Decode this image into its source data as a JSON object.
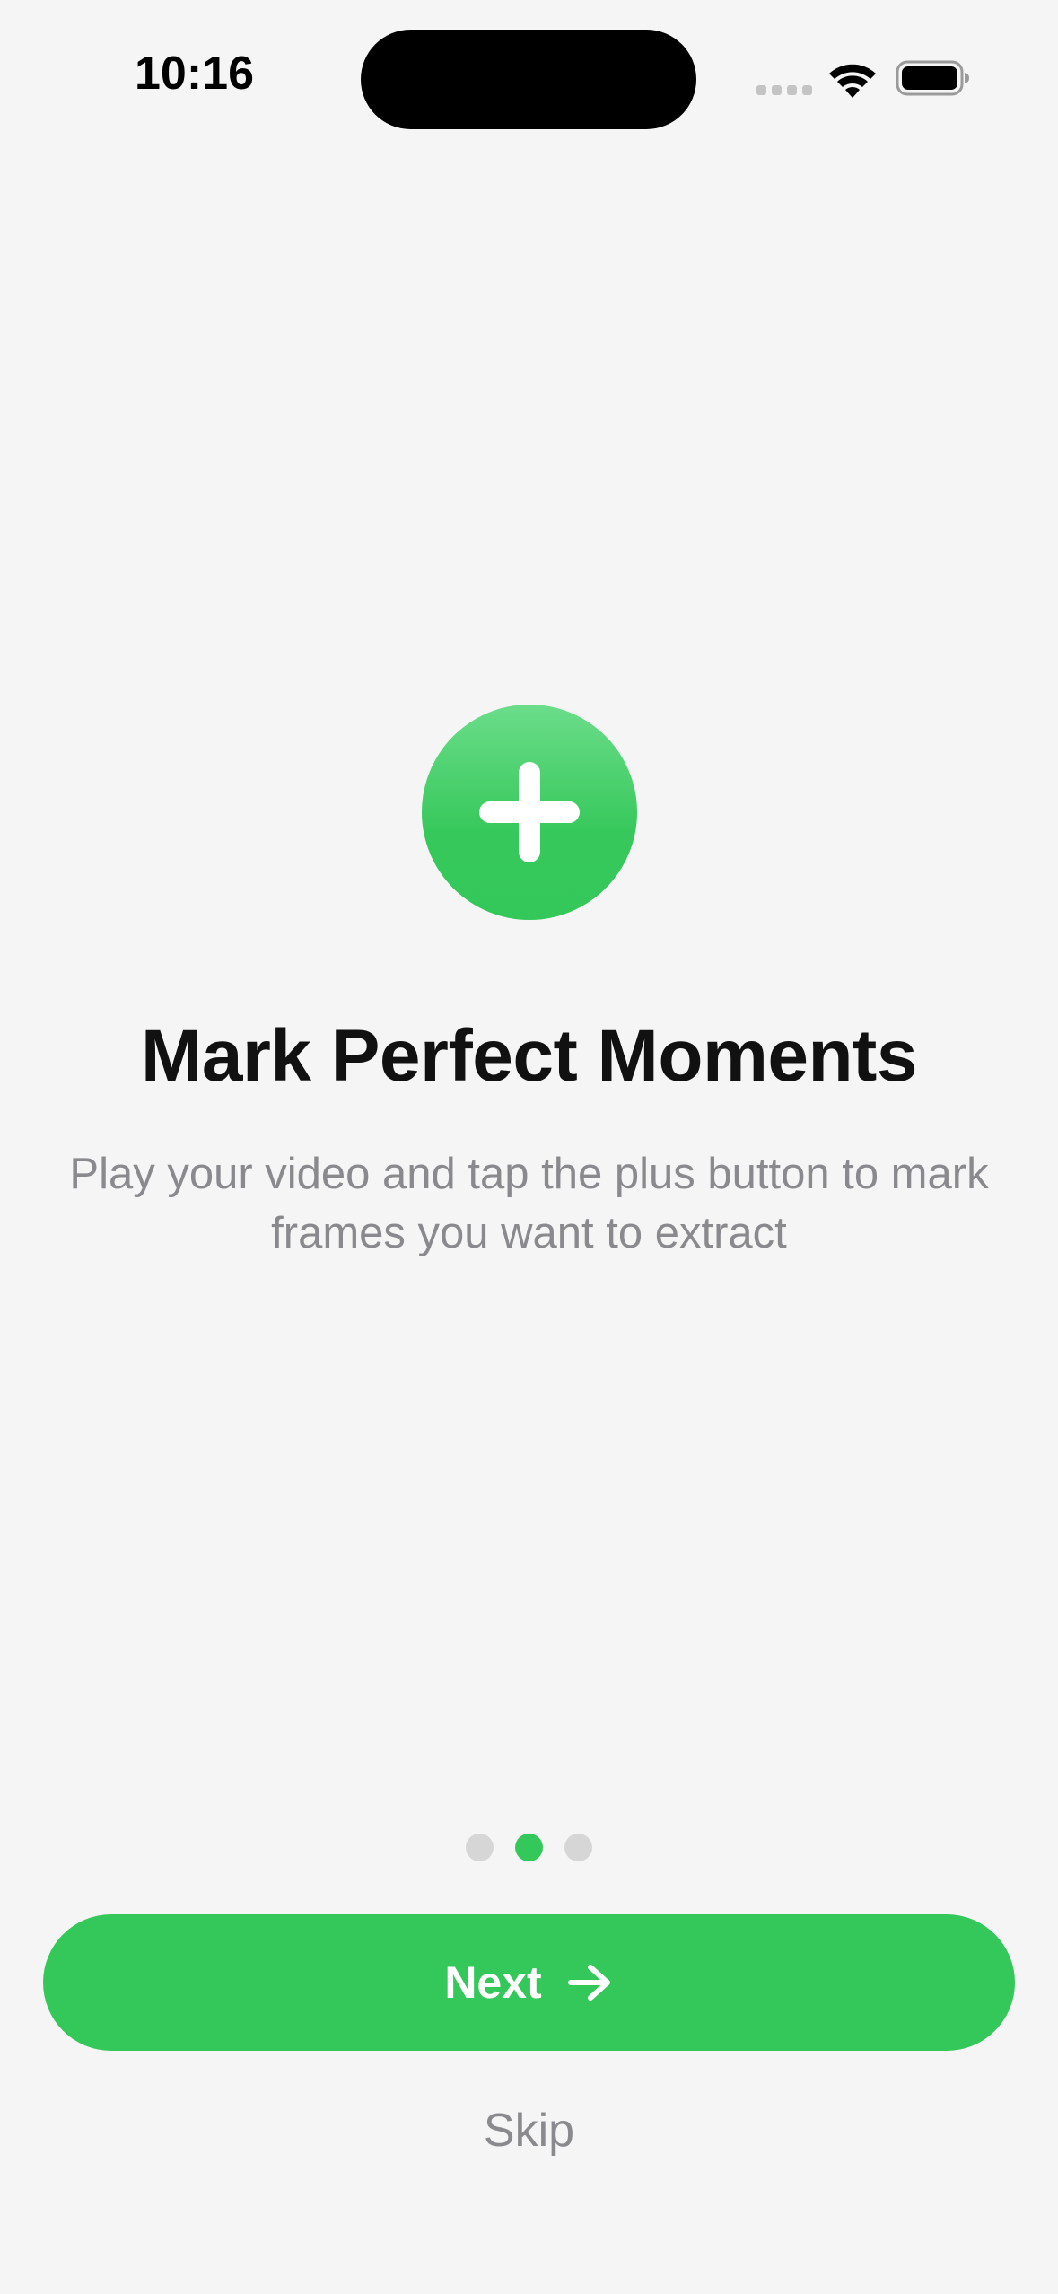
{
  "status_bar": {
    "time": "10:16",
    "icons": [
      "signal-icon",
      "wifi-icon",
      "battery-icon"
    ]
  },
  "onboarding": {
    "hero_icon": "plus-icon",
    "title": "Mark Perfect Moments",
    "description": "Play your video and tap the plus button to mark frames you want to extract",
    "page_indicator": {
      "total": 3,
      "current": 2
    },
    "next_button": {
      "label": "Next",
      "icon": "arrow-right-icon"
    },
    "skip_label": "Skip"
  },
  "colors": {
    "accent": "#34C759",
    "background": "#F5F5F5",
    "secondary_text": "#8A8A8E",
    "inactive_dot": "#D6D6D6"
  }
}
